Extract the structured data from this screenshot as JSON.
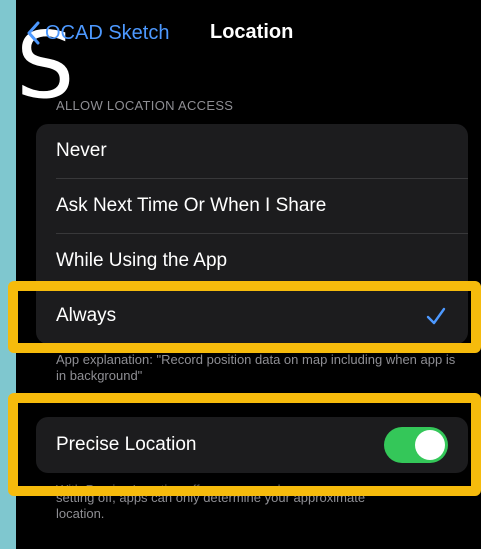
{
  "nav": {
    "back_label": "OCAD Sketch",
    "title": "Location"
  },
  "background_glyph": "S",
  "section_header": "ALLOW LOCATION ACCESS",
  "options": [
    {
      "label": "Never",
      "selected": false
    },
    {
      "label": "Ask Next Time Or When I Share",
      "selected": false
    },
    {
      "label": "While Using the App",
      "selected": false
    },
    {
      "label": "Always",
      "selected": true
    }
  ],
  "app_explanation": "App explanation: \"Record position data on map including when app is in background\"",
  "precise_location": {
    "label": "Precise Location",
    "enabled": true
  },
  "footer": {
    "partial_line": "With Precise Location off, apps can only",
    "line1": "setting off, apps can only determine your approximate",
    "line2": "location."
  },
  "colors": {
    "accent": "#4d99ff",
    "toggle_on": "#34c759",
    "highlight": "#f6bb0c",
    "cell_background": "#1c1c1e",
    "page_background": "#000000",
    "outer_background": "#7fc7cf"
  },
  "icons": {
    "back": "chevron-left-icon",
    "check": "checkmark-icon"
  }
}
